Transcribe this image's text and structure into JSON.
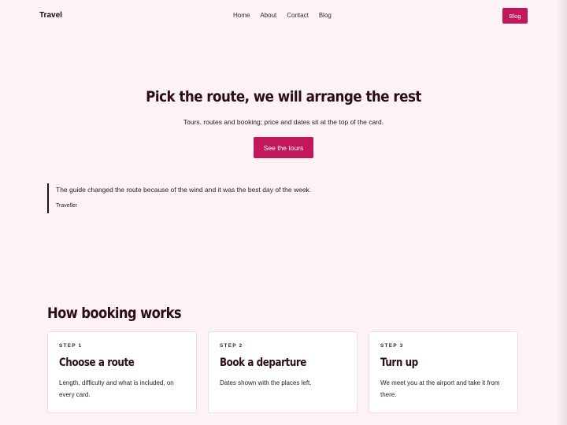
{
  "header": {
    "brand": "Travel",
    "nav": [
      "Home",
      "About",
      "Contact",
      "Blog"
    ],
    "cta_label": "Blog"
  },
  "hero": {
    "title": "Pick the route, we will arrange the rest",
    "subtitle": "Tours, routes and booking; price and dates sit at the top of the card.",
    "cta_label": "See the tours"
  },
  "quote": {
    "text": "The guide changed the route because of the wind and it was the best day of the week.",
    "cite": "Traveller"
  },
  "booking": {
    "title": "How booking works",
    "steps": [
      {
        "step": "STEP 1",
        "title": "Choose a route",
        "text": "Length, difficulty and what is included, on every card."
      },
      {
        "step": "STEP 2",
        "title": "Book a departure",
        "text": "Dates shown with the places left."
      },
      {
        "step": "STEP 3",
        "title": "Turn up",
        "text": "We meet you at the airport and take it from there."
      }
    ]
  },
  "colors": {
    "background": "#fdf3f6",
    "accent": "#c2185b",
    "text": "#2a0f18"
  }
}
